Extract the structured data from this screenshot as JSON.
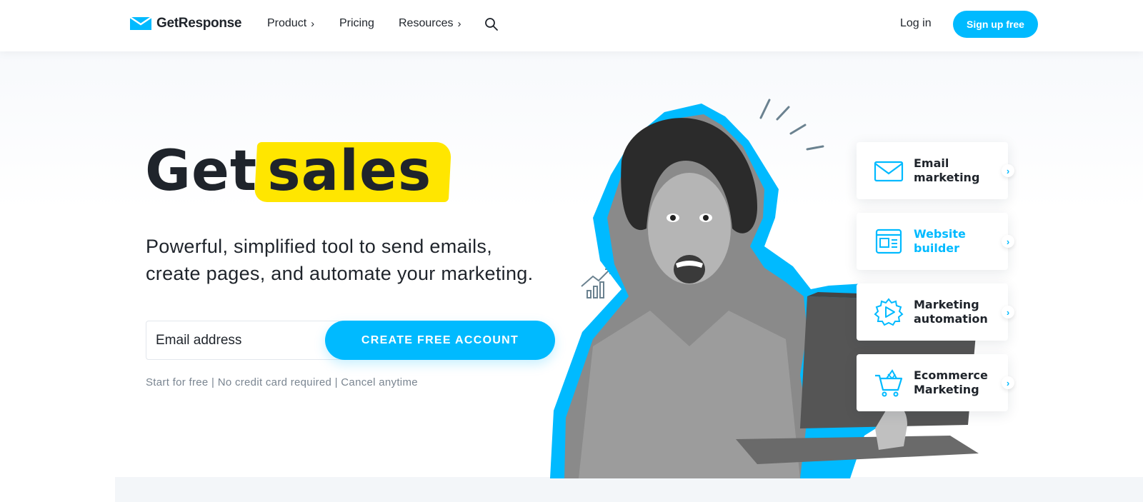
{
  "nav": {
    "logo_text": "GetResponse",
    "items": [
      {
        "label": "Product",
        "has_chevron": true
      },
      {
        "label": "Pricing",
        "has_chevron": false
      },
      {
        "label": "Resources",
        "has_chevron": true
      }
    ],
    "chevron": "›",
    "search_icon": "search-icon",
    "login": "Log in",
    "signup": "Sign up free"
  },
  "hero": {
    "headline_word1": "Get",
    "headline_highlight": "sales",
    "sub_line1": "Powerful, simplified tool to send emails,",
    "sub_line2": "create pages, and automate your marketing.",
    "email_placeholder": "Email address",
    "cta": "CREATE FREE ACCOUNT",
    "note": "Start for free | No credit card required | Cancel anytime"
  },
  "features": [
    {
      "line1": "Email",
      "line2": "marketing",
      "icon": "envelope-icon",
      "active": false
    },
    {
      "line1": "Website",
      "line2": "builder",
      "icon": "website-icon",
      "active": true
    },
    {
      "line1": "Marketing",
      "line2": "automation",
      "icon": "gear-play-icon",
      "active": false
    },
    {
      "line1": "Ecommerce",
      "line2": "Marketing",
      "icon": "cart-icon",
      "active": false
    }
  ],
  "colors": {
    "brand": "#00baff",
    "highlight": "#ffe600",
    "text": "#1f242b",
    "muted": "#7a8591"
  }
}
